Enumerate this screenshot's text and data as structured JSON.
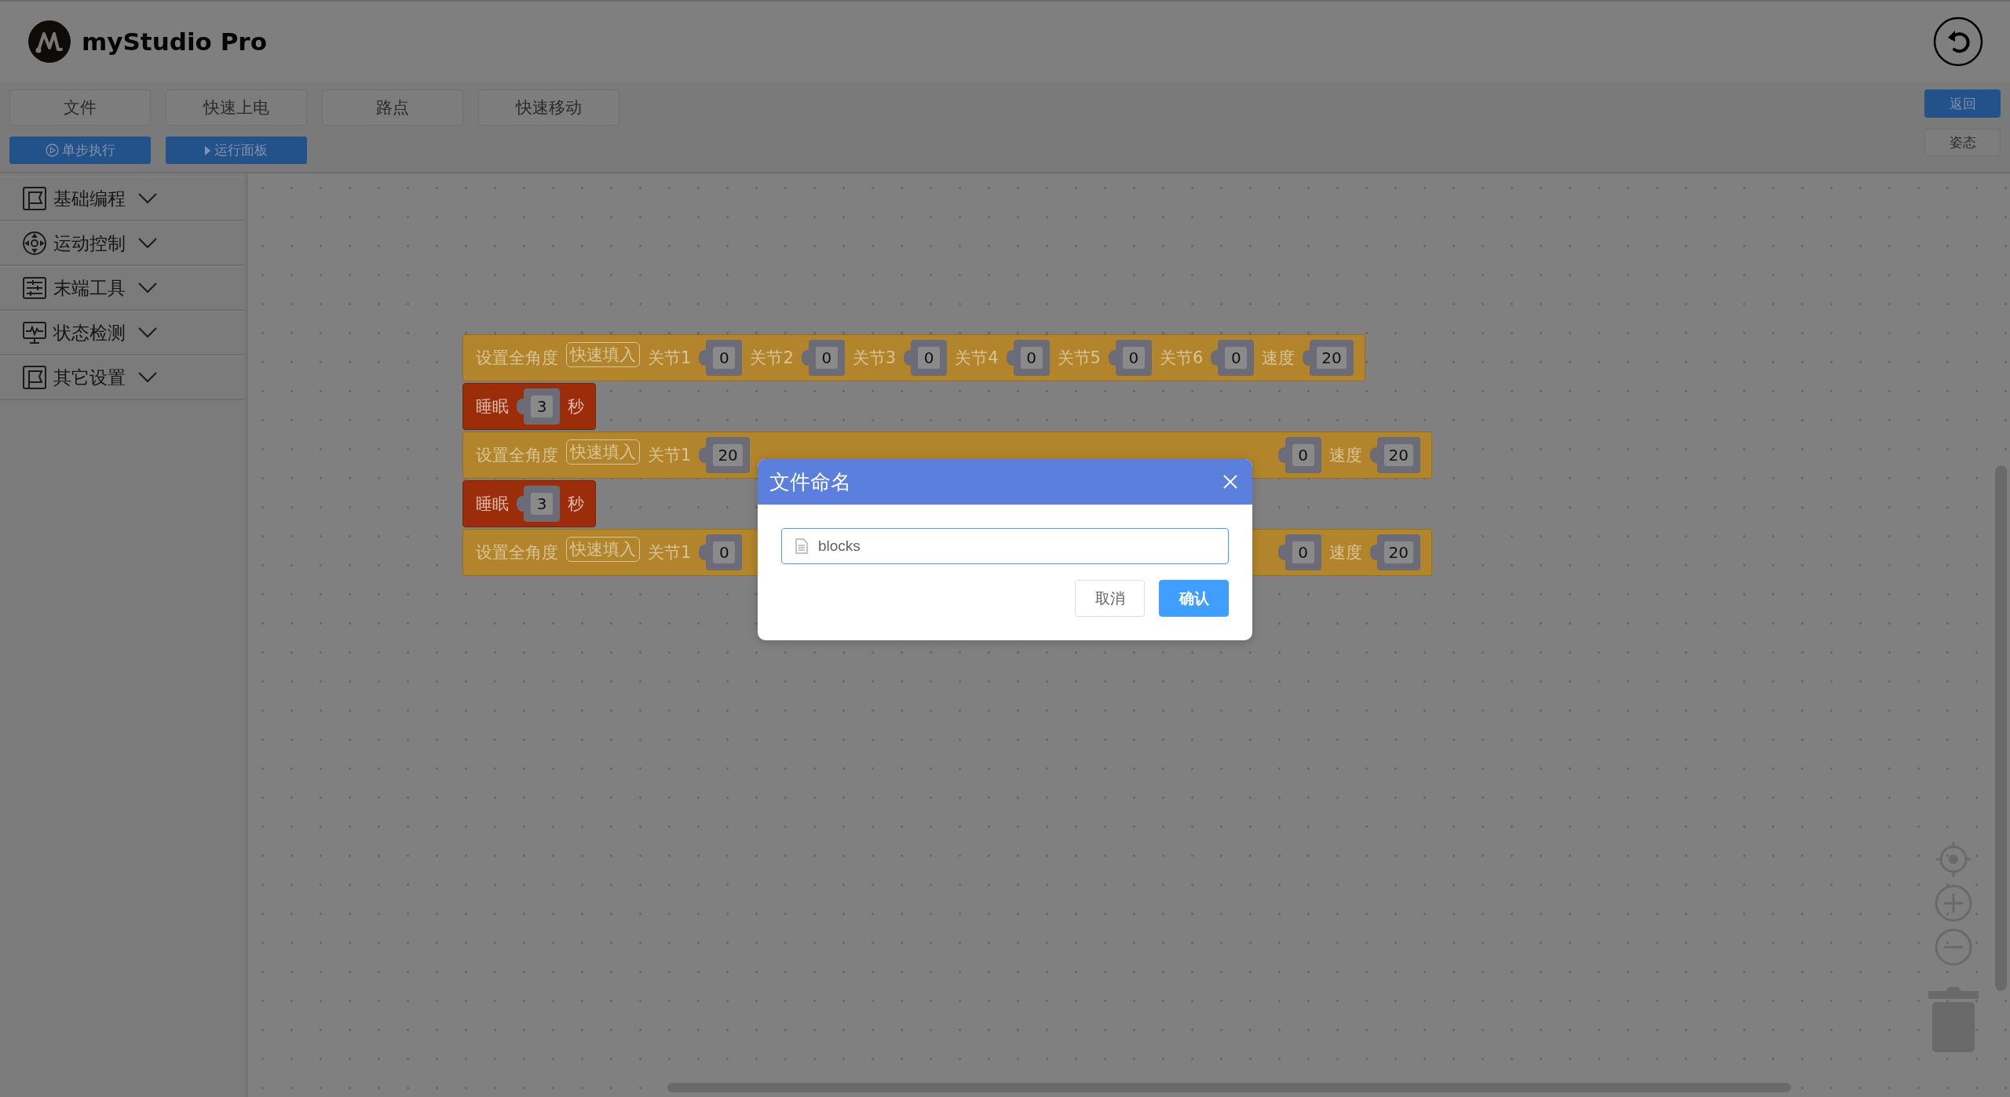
{
  "app": {
    "title": "myStudio Pro"
  },
  "menu_tabs": [
    "文件",
    "快速上电",
    "路点",
    "快速移动"
  ],
  "run_buttons": [
    {
      "kind": "step",
      "label": "单步执行"
    },
    {
      "kind": "panel",
      "label": "运行面板"
    }
  ],
  "right_buttons": [
    {
      "kind": "primary",
      "label": "返回"
    },
    {
      "kind": "plain",
      "label": "姿态"
    }
  ],
  "categories": [
    {
      "kind": "flag",
      "label": "基础编程"
    },
    {
      "kind": "dpad",
      "label": "运动控制"
    },
    {
      "kind": "sliders",
      "label": "末端工具"
    },
    {
      "kind": "monitor",
      "label": "状态检测"
    },
    {
      "kind": "flag",
      "label": "其它设置"
    }
  ],
  "blocks": [
    {
      "kind": "set_angles",
      "items": [
        {
          "kind": "label",
          "text": "设置全角度"
        },
        {
          "kind": "button",
          "text": "快速填入"
        },
        {
          "kind": "label",
          "text": "关节1"
        },
        {
          "kind": "value",
          "text": "0"
        },
        {
          "kind": "label",
          "text": "关节2"
        },
        {
          "kind": "value",
          "text": "0"
        },
        {
          "kind": "label",
          "text": "关节3"
        },
        {
          "kind": "value",
          "text": "0"
        },
        {
          "kind": "label",
          "text": "关节4"
        },
        {
          "kind": "value",
          "text": "0"
        },
        {
          "kind": "label",
          "text": "关节5"
        },
        {
          "kind": "value",
          "text": "0"
        },
        {
          "kind": "label",
          "text": "关节6"
        },
        {
          "kind": "value",
          "text": "0"
        },
        {
          "kind": "label",
          "text": "速度"
        },
        {
          "kind": "value",
          "text": "20"
        }
      ]
    },
    {
      "kind": "sleep",
      "items": [
        {
          "kind": "label",
          "text": "睡眠"
        },
        {
          "kind": "value",
          "text": "3"
        },
        {
          "kind": "label",
          "text": "秒"
        }
      ]
    },
    {
      "kind": "set_angles",
      "items": [
        {
          "kind": "label",
          "text": "设置全角度"
        },
        {
          "kind": "button",
          "text": "快速填入"
        },
        {
          "kind": "label",
          "text": "关节1"
        },
        {
          "kind": "value",
          "text": "20"
        }
      ],
      "trailing_items": [
        {
          "kind": "value",
          "text": "0"
        },
        {
          "kind": "label",
          "text": "速度"
        },
        {
          "kind": "value",
          "text": "20"
        }
      ]
    },
    {
      "kind": "sleep",
      "items": [
        {
          "kind": "label",
          "text": "睡眠"
        },
        {
          "kind": "value",
          "text": "3"
        },
        {
          "kind": "label",
          "text": "秒"
        }
      ]
    },
    {
      "kind": "set_angles",
      "items": [
        {
          "kind": "label",
          "text": "设置全角度"
        },
        {
          "kind": "button",
          "text": "快速填入"
        },
        {
          "kind": "label",
          "text": "关节1"
        },
        {
          "kind": "value",
          "text": "0"
        }
      ],
      "trailing_items": [
        {
          "kind": "value",
          "text": "0"
        },
        {
          "kind": "label",
          "text": "速度"
        },
        {
          "kind": "value",
          "text": "20"
        }
      ]
    }
  ],
  "dialog": {
    "title": "文件命名",
    "input": {
      "value": "blocks"
    },
    "buttons": [
      {
        "kind": "cancel",
        "label": "取消"
      },
      {
        "kind": "confirm",
        "label": "确认"
      }
    ]
  }
}
